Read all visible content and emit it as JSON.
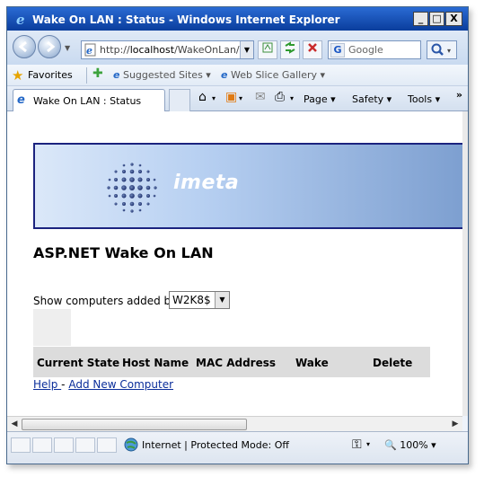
{
  "window": {
    "title": "Wake On LAN : Status - Windows Internet Explorer",
    "min_label": "_",
    "max_label": "□",
    "close_label": "X"
  },
  "address": {
    "url_prefix": "http://",
    "url_host": "localhost",
    "url_path": "/WakeOnLan/"
  },
  "search": {
    "engine_icon_label": "G",
    "placeholder": "Google"
  },
  "favorites": {
    "label": "Favorites",
    "items": [
      {
        "label": "Suggested Sites ▾"
      },
      {
        "label": "Web Slice Gallery ▾"
      }
    ]
  },
  "tabs": [
    {
      "label": "Wake On LAN : Status"
    }
  ],
  "commands": {
    "page": "Page ▾",
    "safety": "Safety ▾",
    "tools": "Tools ▾",
    "more": "»"
  },
  "banner": {
    "brand": "imeta"
  },
  "main": {
    "title": "ASP.NET Wake On LAN",
    "show_label": "Show computers added by:",
    "selected_user": "W2K8$",
    "columns": [
      "Current State",
      "Host Name",
      "MAC Address",
      "Wake",
      "Delete"
    ],
    "help_link": "Help ",
    "separator": "- ",
    "add_link": "Add New Computer"
  },
  "status": {
    "zone": "Internet | Protected Mode: Off",
    "zoom": "100%"
  }
}
